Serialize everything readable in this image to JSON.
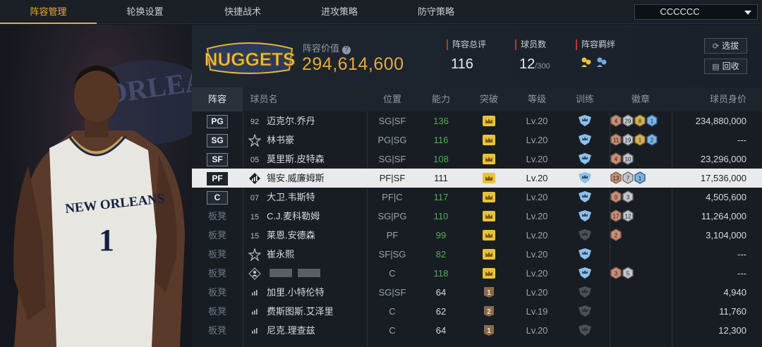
{
  "tabs": [
    {
      "label": "阵容管理",
      "active": true
    },
    {
      "label": "轮换设置",
      "active": false
    },
    {
      "label": "快捷战术",
      "active": false
    },
    {
      "label": "进攻策略",
      "active": false
    },
    {
      "label": "防守策略",
      "active": false
    }
  ],
  "team_select": {
    "value": "CCCCCC"
  },
  "team_logo": {
    "text": "NUGGETS",
    "icon": "nuggets-logo"
  },
  "lineup_value": {
    "label": "阵容价值",
    "value": "294,614,600"
  },
  "stats": {
    "overall": {
      "label": "阵容总评",
      "value": "116"
    },
    "players": {
      "label": "球员数",
      "value": "12",
      "max": "/300"
    },
    "bond": {
      "label": "阵容羁绊",
      "icons": [
        "bond-yellow-icon",
        "bond-blue-icon"
      ]
    }
  },
  "buttons": {
    "select": "选拔",
    "recycle": "回收"
  },
  "columns": [
    "阵容",
    "球员名",
    "位置",
    "能力",
    "突破",
    "等级",
    "训练",
    "徽章",
    "球员身价"
  ],
  "accent": "#e8a93a",
  "rows": [
    {
      "lineup": "PG",
      "starter": true,
      "type": "jersey",
      "jersey": "92",
      "name": "迈克尔.乔丹",
      "position": "SG|SF",
      "ability": "136",
      "break": "crown",
      "level": "Lv.20",
      "train": "shield-blue",
      "badges": [
        {
          "n": "4",
          "c": "bronze"
        },
        {
          "n": "29",
          "c": "silver"
        },
        {
          "n": "8",
          "c": "gold"
        },
        {
          "n": "1",
          "c": "blue"
        }
      ],
      "value": "234,880,000"
    },
    {
      "lineup": "SG",
      "starter": true,
      "type": "star",
      "jersey": "",
      "name": "林书豪",
      "position": "PG|SG",
      "ability": "116",
      "break": "crown",
      "level": "Lv.20",
      "train": "shield-blue",
      "badges": [
        {
          "n": "11",
          "c": "bronze"
        },
        {
          "n": "19",
          "c": "silver"
        },
        {
          "n": "1",
          "c": "gold"
        },
        {
          "n": "2",
          "c": "blue"
        }
      ],
      "value": "---"
    },
    {
      "lineup": "SF",
      "starter": true,
      "type": "jersey",
      "jersey": "05",
      "name": "莫里斯.皮特森",
      "position": "SG|SF",
      "ability": "108",
      "break": "crown",
      "level": "Lv.20",
      "train": "shield-blue",
      "badges": [
        {
          "n": "4",
          "c": "bronze"
        },
        {
          "n": "10",
          "c": "silver"
        }
      ],
      "value": "23,296,000"
    },
    {
      "lineup": "PF",
      "starter": true,
      "selected": true,
      "type": "bars",
      "jersey": "",
      "name": "锡安.威廉姆斯",
      "position": "PF|SF",
      "ability": "111",
      "break": "crown",
      "level": "Lv.20",
      "train": "shield-blue",
      "badges": [
        {
          "n": "13",
          "c": "bronze"
        },
        {
          "n": "7",
          "c": "silver"
        },
        {
          "n": "1",
          "c": "blue"
        }
      ],
      "value": "17,536,000"
    },
    {
      "lineup": "C",
      "starter": true,
      "type": "jersey",
      "jersey": "07",
      "name": "大卫.韦斯特",
      "position": "PF|C",
      "ability": "117",
      "break": "crown",
      "level": "Lv.20",
      "train": "shield-blue",
      "badges": [
        {
          "n": "0",
          "c": "bronze"
        },
        {
          "n": "3",
          "c": "silver"
        }
      ],
      "value": "4,505,600"
    },
    {
      "lineup": "板凳",
      "starter": false,
      "type": "jersey",
      "jersey": "15",
      "name": "C.J.麦科勒姆",
      "position": "SG|PG",
      "ability": "110",
      "break": "crown",
      "level": "Lv.20",
      "train": "shield-blue",
      "badges": [
        {
          "n": "17",
          "c": "bronze"
        },
        {
          "n": "12",
          "c": "silver"
        }
      ],
      "value": "11,264,000"
    },
    {
      "lineup": "板凳",
      "starter": false,
      "type": "jersey",
      "jersey": "15",
      "name": "莱恩.安德森",
      "position": "PF",
      "ability": "99",
      "break": "crown",
      "level": "Lv.20",
      "train": "shield-gray",
      "badges": [
        {
          "n": "2",
          "c": "bronze"
        }
      ],
      "value": "3,104,000"
    },
    {
      "lineup": "板凳",
      "starter": false,
      "type": "star",
      "jersey": "",
      "name": "崔永熙",
      "position": "SF|SG",
      "ability": "82",
      "break": "crown",
      "level": "Lv.20",
      "train": "shield-blue",
      "badges": [],
      "value": "---"
    },
    {
      "lineup": "板凳",
      "starter": false,
      "type": "person",
      "jersey": "",
      "name": "",
      "blurred": true,
      "position": "C",
      "ability": "118",
      "break": "crown",
      "level": "Lv.20",
      "train": "shield-blue",
      "badges": [
        {
          "n": "3",
          "c": "bronze"
        },
        {
          "n": "5",
          "c": "silver"
        }
      ],
      "value": "---"
    },
    {
      "lineup": "板凳",
      "starter": false,
      "type": "bars",
      "jersey": "",
      "name": "加里.小特伦特",
      "position": "SG|SF",
      "ability": "64",
      "break": "1",
      "level": "Lv.20",
      "train": "shield-gray",
      "badges": [],
      "value": "4,940"
    },
    {
      "lineup": "板凳",
      "starter": false,
      "type": "bars",
      "jersey": "",
      "name": "费斯图斯.艾泽里",
      "position": "C",
      "ability": "62",
      "break": "2",
      "level": "Lv.19",
      "train": "shield-gray",
      "badges": [],
      "value": "11,760"
    },
    {
      "lineup": "板凳",
      "starter": false,
      "type": "bars",
      "jersey": "",
      "name": "尼克.理查兹",
      "position": "C",
      "ability": "64",
      "break": "1",
      "level": "Lv.20",
      "train": "shield-gray",
      "badges": [],
      "value": "12,300"
    }
  ],
  "portrait": {
    "jersey_text": "NEW ORLEANS",
    "jersey_number": "1",
    "icon": "player-portrait"
  }
}
